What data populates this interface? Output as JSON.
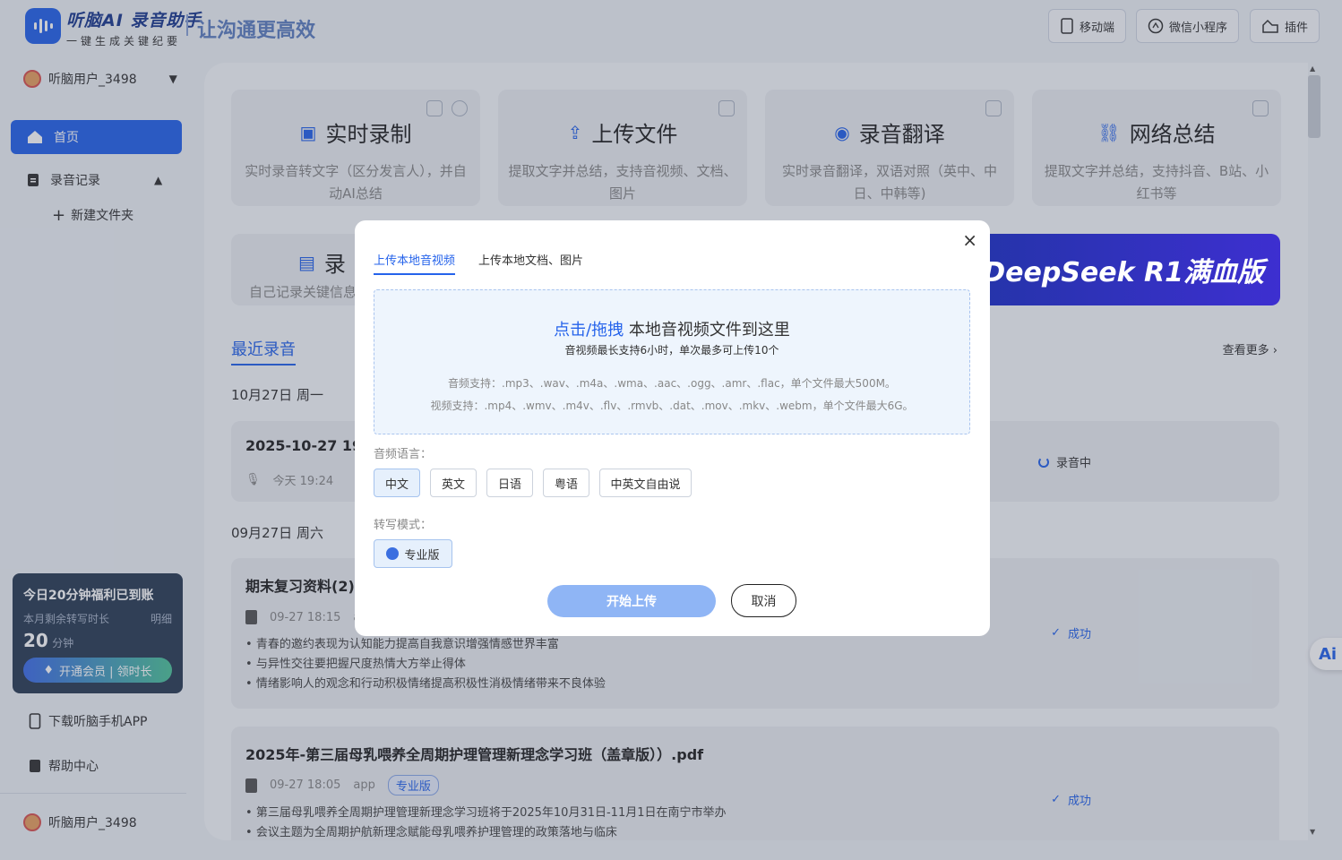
{
  "header": {
    "app_name": "听脑AI 录音助手",
    "app_sub": "一键生成关键纪要",
    "slogan": "让沟通更高效",
    "buttons": [
      "移动端",
      "微信小程序",
      "插件"
    ]
  },
  "sidebar": {
    "username": "听脑用户_3498",
    "items": [
      {
        "label": "首页"
      },
      {
        "label": "录音记录"
      },
      {
        "label": "新建文件夹"
      }
    ],
    "promo": {
      "title": "今日20分钟福利已到账",
      "remain_label": "本月剩余转写时长",
      "detail_link": "明细",
      "minutes": "20",
      "unit": "分钟",
      "cta": "开通会员 | 领时长"
    },
    "download_app": "下载听脑手机APP",
    "help": "帮助中心",
    "footer_user": "听脑用户_3498"
  },
  "cards": [
    {
      "title": "实时录制",
      "desc": "实时录音转文字（区分发言人），并自动AI总结"
    },
    {
      "title": "上传文件",
      "desc": "提取文字并总结，支持音视频、文档、图片"
    },
    {
      "title": "录音翻译",
      "desc": "实时录音翻译，双语对照（英中、中日、中韩等)"
    },
    {
      "title": "网络总结",
      "desc": "提取文字并总结，支持抖音、B站、小红书等"
    },
    {
      "title": "录",
      "desc": "自己记录关键信息"
    }
  ],
  "banner_text": "DeepSeek R1满血版",
  "recent": {
    "title": "最近录音",
    "more": "查看更多 ›",
    "groups": [
      {
        "date": "10月27日 周一",
        "records": [
          {
            "title": "2025-10-27 19:2",
            "time": "今天 19:24",
            "status": "录音中"
          }
        ]
      },
      {
        "date": "09月27日 周六",
        "records": [
          {
            "title": "期末复习资料(2).",
            "time": "09-27 18:15",
            "source": "a",
            "status": "成功",
            "bullets": [
              "青春的邀约表现为认知能力提高自我意识增强情感世界丰富",
              "与异性交往要把握尺度热情大方举止得体",
              "情绪影响人的观念和行动积极情绪提高积极性消极情绪带来不良体验"
            ]
          },
          {
            "title": "2025年-第三届母乳喂养全周期护理管理新理念学习班（盖章版））.pdf",
            "time": "09-27 18:05",
            "source": "app",
            "badge": "专业版",
            "status": "成功",
            "bullets": [
              "第三届母乳喂养全周期护理管理新理念学习班将于2025年10月31日-11月1日在南宁市举办",
              "会议主题为全周期护航新理念赋能母乳喂养护理管理的政策落地与临床"
            ]
          }
        ]
      }
    ]
  },
  "modal": {
    "tabs": [
      "上传本地音视频",
      "上传本地文档、图片"
    ],
    "drop_link": "点击/拖拽",
    "drop_text": " 本地音视频文件到这里",
    "drop_sub": "音视频最长支持6小时，单次最多可上传10个",
    "audio_support": "音频支持：.mp3、.wav、.m4a、.wma、.aac、.ogg、.amr、.flac，单个文件最大500M。",
    "video_support": "视频支持：.mp4、.wmv、.m4v、.flv、.rmvb、.dat、.mov、.mkv、.webm，单个文件最大6G。",
    "lang_label": "音频语言：",
    "languages": [
      "中文",
      "英文",
      "日语",
      "粤语",
      "中英文自由说"
    ],
    "mode_label": "转写模式：",
    "mode": "专业版",
    "start": "开始上传",
    "cancel": "取消"
  },
  "floating": "Ai"
}
